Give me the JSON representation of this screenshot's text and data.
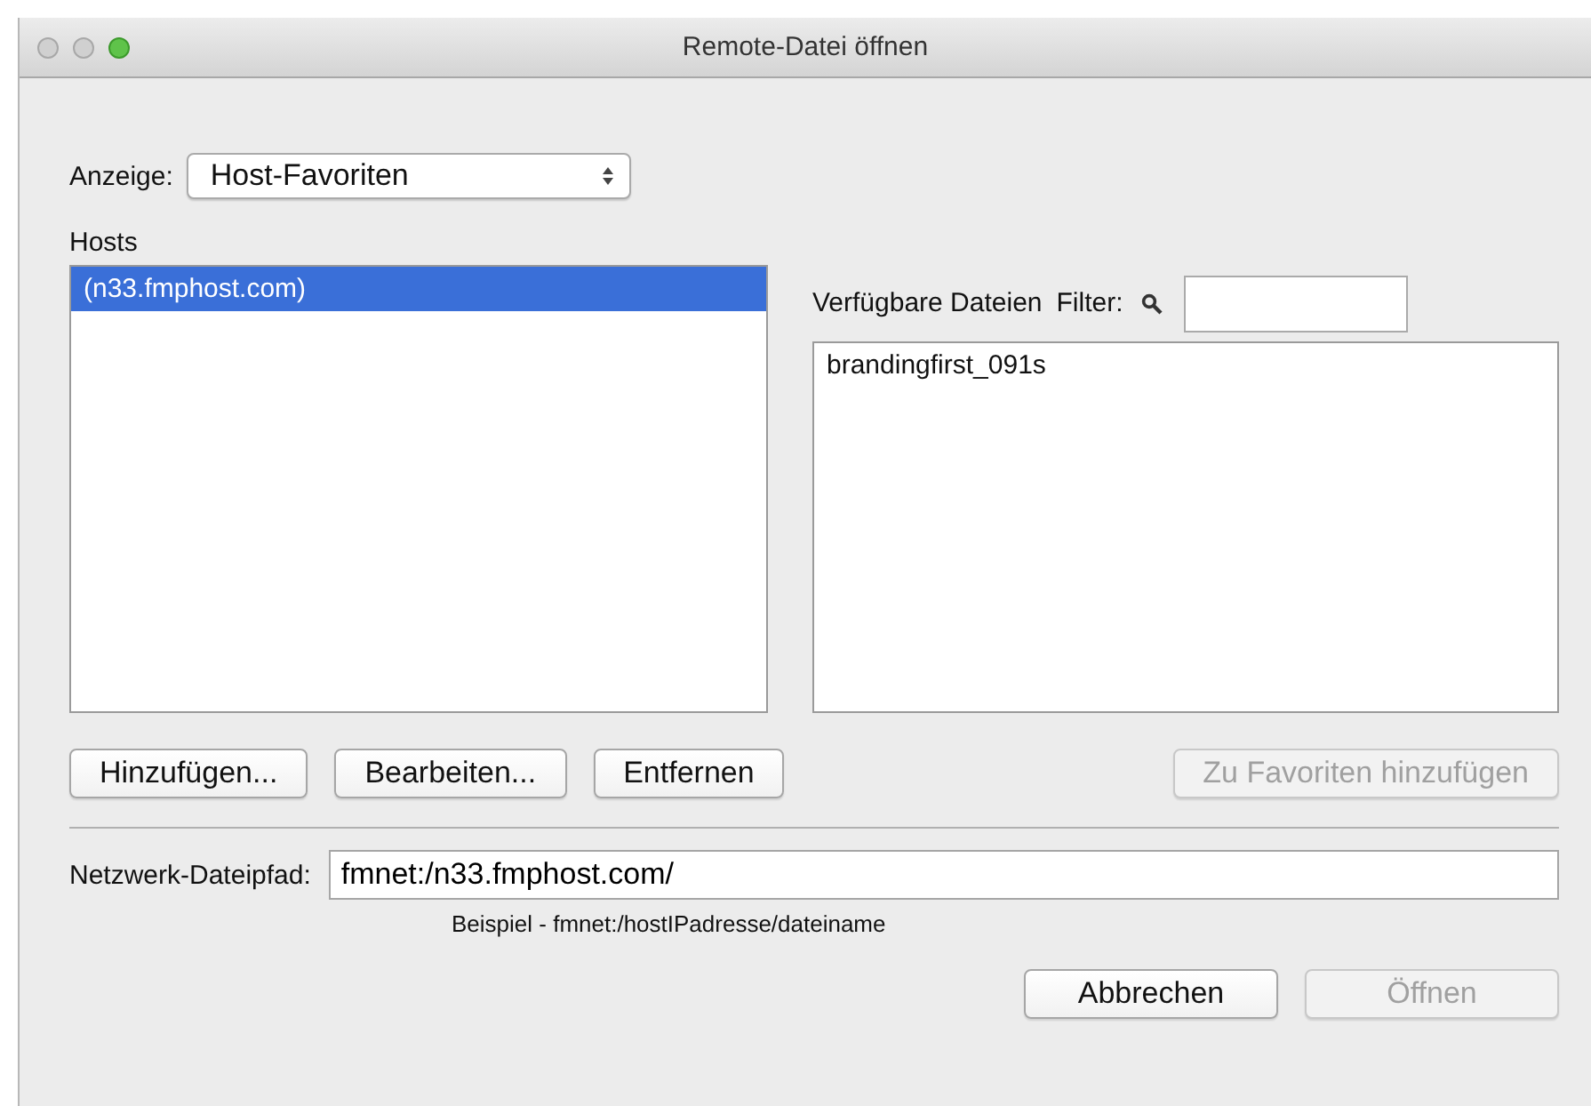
{
  "window": {
    "title": "Remote-Datei öffnen"
  },
  "view": {
    "label": "Anzeige:",
    "value": "Host-Favoriten"
  },
  "hosts": {
    "label": "Hosts",
    "items": [
      {
        "text": "(n33.fmphost.com)",
        "selected": true
      }
    ]
  },
  "files": {
    "label": "Verfügbare Dateien",
    "filter_label": "Filter:",
    "items": [
      {
        "text": "brandingfirst_091s",
        "selected": false
      }
    ]
  },
  "host_buttons": [
    {
      "label": "Hinzufügen...",
      "disabled": false
    },
    {
      "label": "Bearbeiten...",
      "disabled": false
    },
    {
      "label": "Entfernen",
      "disabled": false
    }
  ],
  "favorite_button": {
    "label": "Zu Favoriten hinzufügen",
    "disabled": true
  },
  "path": {
    "label": "Netzwerk-Dateipfad:",
    "value": "fmnet:/n33.fmphost.com/",
    "hint": "Beispiel - fmnet:/hostIPadresse/dateiname"
  },
  "buttons": [
    {
      "label": "Abbrechen",
      "disabled": false
    },
    {
      "label": "Öffnen",
      "disabled": true
    }
  ]
}
